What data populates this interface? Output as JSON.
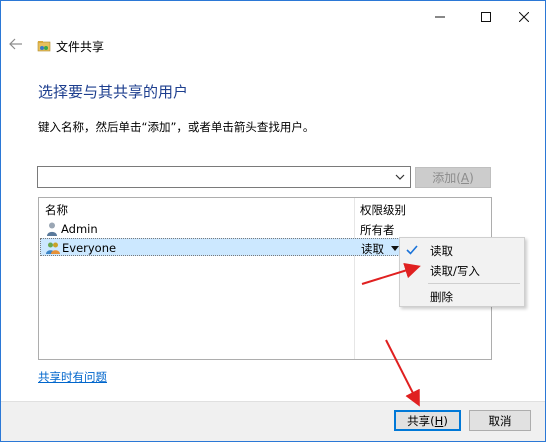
{
  "window": {
    "title": "文件共享",
    "caption_buttons": [
      "minimize",
      "maximize",
      "close"
    ]
  },
  "page": {
    "heading": "选择要与其共享的用户",
    "instruction": "键入名称，然后单击“添加”，或者单击箭头查找用户。"
  },
  "input": {
    "value": "",
    "placeholder": ""
  },
  "add_button": {
    "label_prefix": "添加(",
    "label_key": "A",
    "label_suffix": ")"
  },
  "table": {
    "headers": {
      "name": "名称",
      "permission": "权限级别"
    },
    "rows": [
      {
        "name": "Admin",
        "permission": "所有者",
        "icon": "user-icon"
      },
      {
        "name": "Everyone",
        "permission": "读取",
        "icon": "group-icon"
      }
    ]
  },
  "permission_menu": {
    "items": [
      {
        "label": "读取",
        "checked": true
      },
      {
        "label": "读取/写入",
        "checked": false
      },
      {
        "label": "删除",
        "checked": false
      }
    ]
  },
  "trouble_link": "共享时有问题",
  "footer": {
    "share_prefix": "共享(",
    "share_key": "H",
    "share_suffix": ")",
    "cancel": "取消"
  },
  "colors": {
    "accent": "#0078d7",
    "heading": "#1e3f8f",
    "selection": "#cce8ff",
    "annotation_arrow": "#e02020"
  }
}
